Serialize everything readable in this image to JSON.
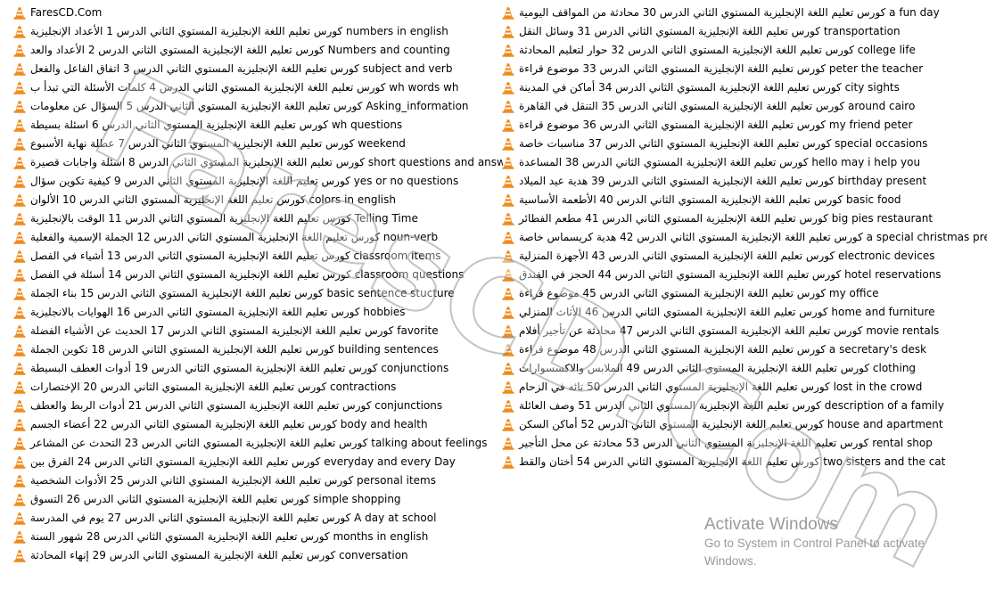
{
  "colors": {
    "cone_orange": "#f08a1c",
    "cone_stripe": "#ffffff",
    "watermark_text": "#b0b0b0",
    "activation_text": "#9a9a9a"
  },
  "icons": {
    "file": "vlc-cone-icon"
  },
  "watermark": {
    "text": "FaresCD.Com"
  },
  "left_column": [
    "FaresCD.Com",
    "كورس تعليم اللغة الإنجليزية المستوي الثاني الدرس 1 الأعداد الإنجليزية numbers in english",
    "كورس تعليم اللغة الإنجليزية المستوي الثاني الدرس 2 الأعداد والعد Numbers and counting",
    "كورس تعليم اللغة الإنجليزية المستوي الثاني الدرس 3 اتفاق الفاعل والفعل subject and verb",
    "كورس تعليم اللغة الإنجليزية المستوي الثاني الدرس 4 كلمات الأسئلة التي تبدأ ب wh words wh",
    "كورس تعليم اللغة الإنجليزية المستوي الثاني الدرس 5 السؤال عن معلومات Asking_information",
    "كورس تعليم اللغة الإنجليزية المستوي الثاني الدرس 6 اسئلة بسيطة wh questions",
    "كورس تعليم اللغة الإنجليزية المستوي الثاني الدرس 7 عطلة نهاية الأسبوع weekend",
    "كورس تعليم اللغة الإنجليزية المستوي الثاني الدرس 8 اسئلة واجابات قصيرة short questions and answers",
    "كورس تعليم اللغة الإنجليزية المستوي الثاني الدرس 9 كيفية تكوين سؤال yes or no questions",
    "كورس تعليم اللغة الإنجليزية المستوي الثاني الدرس 10 الألوان colors in english",
    "كورس تعليم اللغة الإنجليزية المستوي الثاني الدرس 11 الوقت بالإنجليزية Telling Time",
    "كورس تعليم اللغة الإنجليزية المستوي الثاني الدرس 12 الجملة الإسمية والفعلية noun-verb",
    "كورس تعليم اللغة الإنجليزية المستوي الثاني الدرس 13 أشياء في الفصل classroom items",
    "كورس تعليم اللغة الإنجليزية المستوي الثاني الدرس 14 أسئلة في الفصل classroom questions",
    "كورس تعليم اللغة الإنجليزية المستوي الثاني الدرس 15 بناء الجملة basic sentence stucture",
    "كورس تعليم اللغة الإنجليزية المستوي الثاني الدرس 16 الهوايات بالانجليزية hobbies",
    "كورس تعليم اللغة الإنجليزية المستوي الثاني الدرس 17 الحديث عن الأشياء الفضلة favorite",
    "كورس تعليم اللغة الإنجليزية المستوي الثاني الدرس 18 تكوين الجملة building sentences",
    "كورس تعليم اللغة الإنجليزية المستوي الثاني الدرس 19 أدوات العطف البسيطة conjunctions",
    "كورس تعليم اللغة الإنجليزية المستوي الثاني الدرس 20 الإختصارات contractions",
    "كورس تعليم اللغة الإنجليزية المستوي الثاني الدرس 21 أدوات الربط والعطف conjunctions",
    "كورس تعليم اللغة الإنجليزية المستوي الثاني الدرس 22 أعضاء الجسم body and health",
    "كورس تعليم اللغة الإنجليزية المستوي الثاني الدرس 23 التحدث عن المشاعر talking about feelings",
    "كورس تعليم اللغة الإنجليزية المستوي الثاني الدرس 24 الفرق بين everyday and every Day",
    "كورس تعليم اللغة الإنجليزية المستوي الثاني الدرس 25 الأدوات الشخصية personal items",
    "كورس تعليم اللغة الإنجليزية المستوي الثاني الدرس 26 التسوق simple shopping",
    "كورس تعليم اللغة الإنجليزية المستوي الثاني الدرس 27 يوم في المدرسة A day at school",
    "كورس تعليم اللغة الإنجليزية المستوي الثاني الدرس 28 شهور السنة months in english",
    "كورس تعليم اللغة الإنجليزية المستوي الثاني الدرس 29 إنهاء المحادثة conversation"
  ],
  "right_column": [
    "كورس تعليم اللغة الإنجليزية المستوي الثاني الدرس 30 محادثة من المواقف اليومية a fun day",
    "كورس تعليم اللغة الإنجليزية المستوي الثاني الدرس 31 وسائل النقل transportation",
    "كورس تعليم اللغة الإنجليزية المستوي الثاني الدرس 32 حوار لتعليم المحادثة college life",
    "كورس تعليم اللغة الإنجليزية المستوي الثاني الدرس 33 موضوع قراءة peter the teacher",
    "كورس تعليم اللغة الإنجليزية المستوي الثاني الدرس 34 أماكن في المدينة city sights",
    "كورس تعليم اللغة الإنجليزية المستوي الثاني الدرس 35 التنقل في القاهرة around cairo",
    "كورس تعليم اللغة الإنجليزية المستوي الثاني الدرس 36 موضوع قراءة my friend peter",
    "كورس تعليم اللغة الإنجليزية المستوي الثاني الدرس 37 مناسبات خاصة special occasions",
    "كورس تعليم اللغة الإنجليزية المستوي الثاني الدرس 38 المساعدة hello may i help you",
    "كورس تعليم اللغة الإنجليزية المستوي الثاني الدرس 39 هدية عيد الميلاد birthday present",
    "كورس تعليم اللغة الإنجليزية المستوي الثاني الدرس 40 الأطعمة الأساسية basic food",
    "كورس تعليم اللغة الإنجليزية المستوي الثاني الدرس 41 مطعم الفطائر big pies restaurant",
    "كورس تعليم اللغة الإنجليزية المستوي الثاني الدرس 42 هدية كريسماس خاصة a special christmas present",
    "كورس تعليم اللغة الإنجليزية المستوي الثاني الدرس 43 الأجهزة المنزلية electronic devices",
    "كورس تعليم اللغة الإنجليزية المستوي الثاني الدرس 44 الحجز في الفندق hotel reservations",
    "كورس تعليم اللغة الإنجليزية المستوي الثاني الدرس 45 موضوع قراءة my office",
    "كورس تعليم اللغة الإنجليزية المستوي الثاني الدرس 46 الأثاث المنزلي home and furniture",
    "كورس تعليم اللغة الإنجليزية المستوي الثاني الدرس 47 محادثة عن تأجير أفلام movie rentals",
    "كورس تعليم اللغة الإنجليزية المستوي الثاني الدرس 48 موضوع قراءة a secretary's desk",
    "كورس تعليم اللغة الإنجليزية المستوي الثاني الدرس 49 الملابس والاكسسوارات clothing",
    "كورس تعليم اللغة الإنجليزية المستوي الثاني الدرس 50 تائه في الزحام lost in the crowd",
    "كورس تعليم اللغة الإنجليزية المستوي الثاني الدرس 51 وصف العائلة description of a family",
    "كورس تعليم اللغة الإنجليزية المستوي الثاني الدرس 52 أماكن السكن house and apartment",
    "كورس تعليم اللغة الإنجليزية المستوي الثاني الدرس 53 محادثة عن محل التأجير rental shop",
    "كورس تعليم اللغة الإنجليزية المستوي الثاني الدرس 54 أختان والقط two sisters and the cat"
  ],
  "activation": {
    "title": "Activate Windows",
    "message": "Go to System in Control Panel to activate Windows."
  }
}
